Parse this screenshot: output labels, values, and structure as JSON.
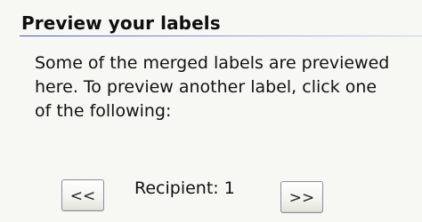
{
  "section": {
    "title": "Preview your labels",
    "description": "Some of the merged labels are previewed here. To preview another label, click one of the following:"
  },
  "navigation": {
    "prev_label": "<<",
    "recipient_text": "Recipient: 1",
    "next_label": ">>"
  }
}
